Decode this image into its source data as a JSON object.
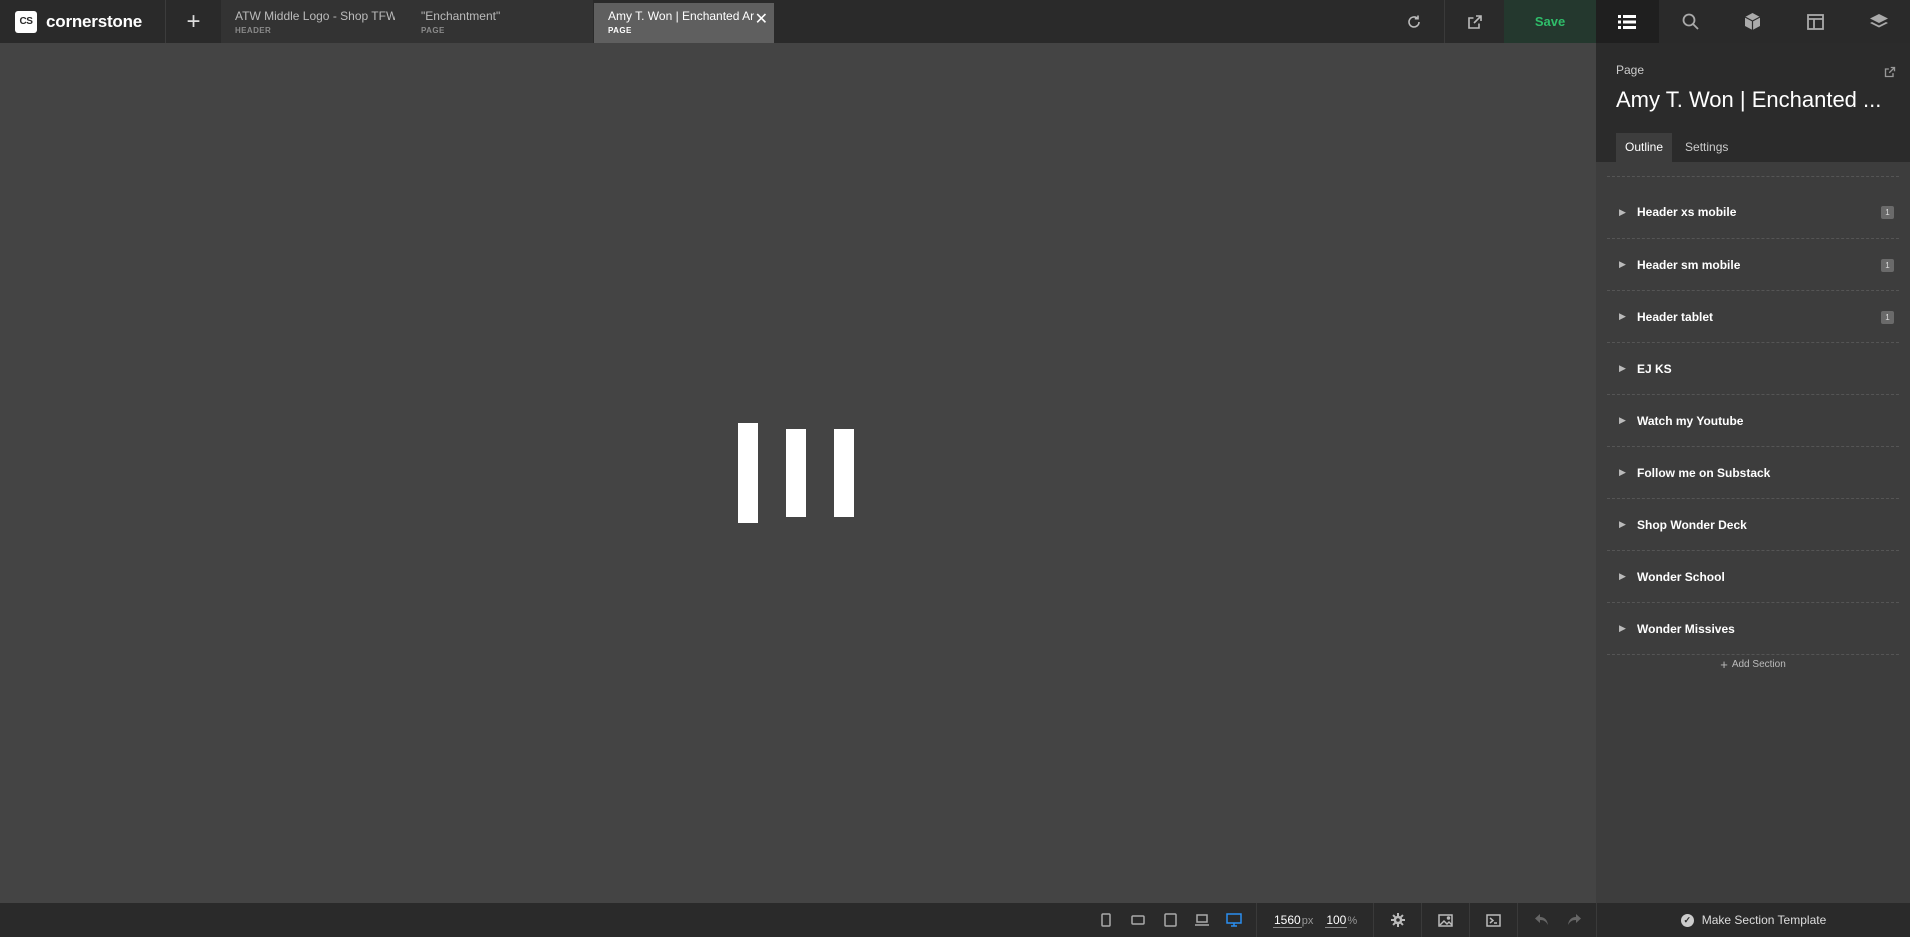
{
  "app": {
    "logo_badge": "CS",
    "logo_text": "cornerstone"
  },
  "tabs": [
    {
      "title": "ATW Middle Logo - Shop TFW",
      "type": "HEADER"
    },
    {
      "title": "\"Enchantment\"",
      "type": "PAGE"
    },
    {
      "title": "Amy T. Won | Enchanted Ar",
      "type": "PAGE",
      "active": true
    }
  ],
  "toolbar": {
    "save_label": "Save"
  },
  "panel": {
    "label": "Page",
    "title": "Amy T. Won | Enchanted ...",
    "tabs": [
      "Outline",
      "Settings"
    ],
    "sections": [
      {
        "label": "Header xs mobile",
        "count": "1"
      },
      {
        "label": "Header sm mobile",
        "count": "1"
      },
      {
        "label": "Header tablet",
        "count": "1"
      },
      {
        "label": "EJ KS"
      },
      {
        "label": "Watch my Youtube"
      },
      {
        "label": "Follow me on Substack"
      },
      {
        "label": "Shop Wonder Deck"
      },
      {
        "label": "Wonder School"
      },
      {
        "label": "Wonder Missives"
      }
    ],
    "add_section_label": "Add Section"
  },
  "bottom": {
    "width_value": "1560",
    "width_unit": "px",
    "zoom_value": "100",
    "zoom_unit": "%",
    "make_template_label": "Make Section Template"
  },
  "colors": {
    "accent_green": "#2fbe6a",
    "accent_blue": "#2b8ef0"
  }
}
